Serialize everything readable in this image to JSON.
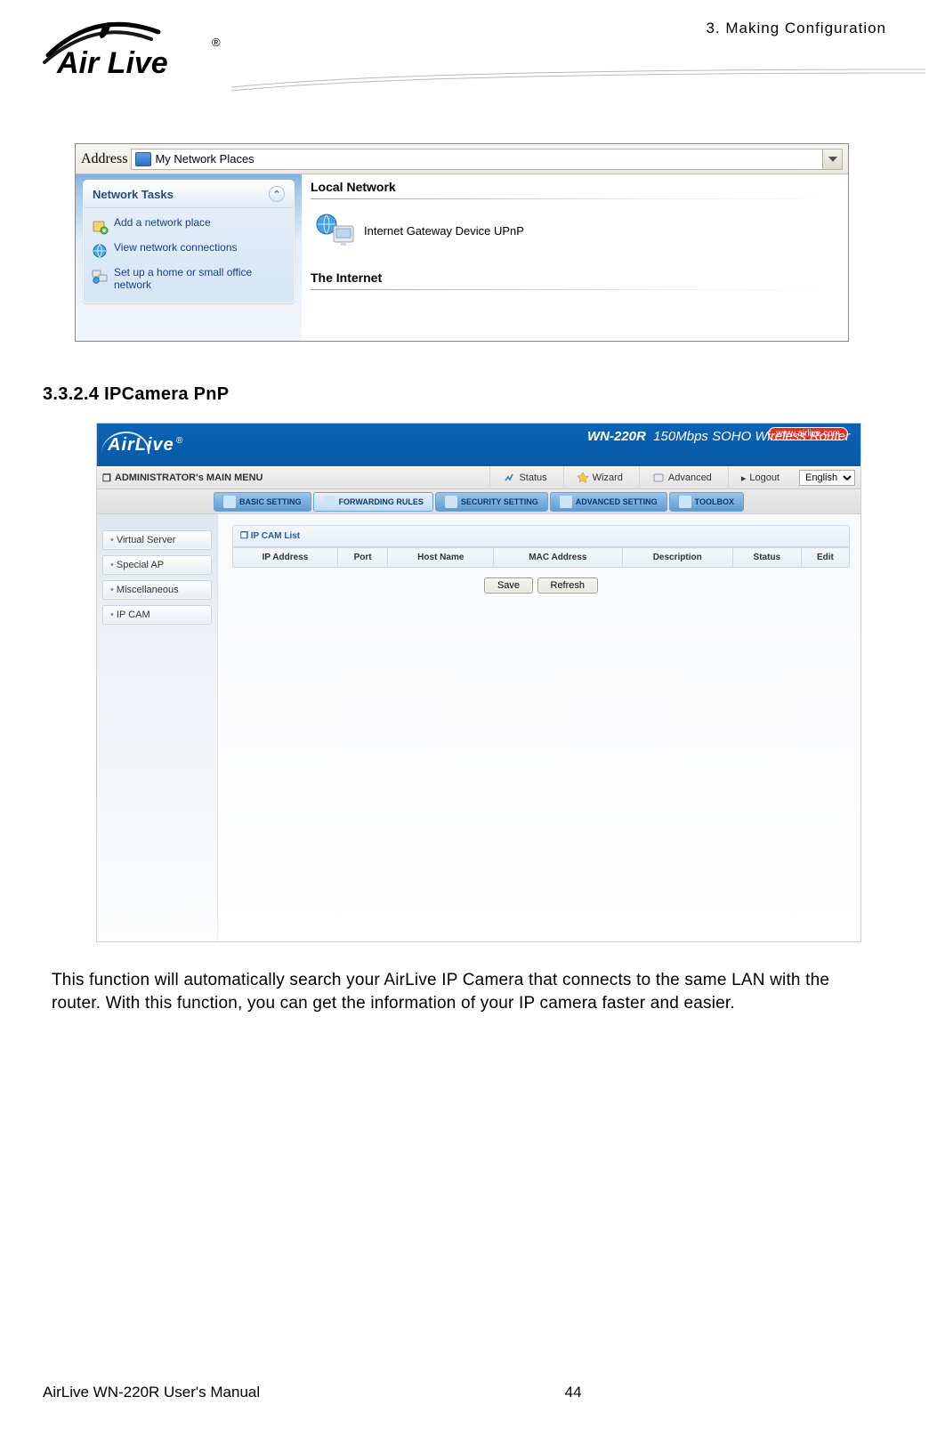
{
  "chapter_header": "3. Making Configuration",
  "logo_text": "Air Live",
  "logo_reg": "®",
  "screenshot1": {
    "address_label": "Address",
    "address_value": "My Network Places",
    "panel_title": "Network Tasks",
    "tasks": {
      "add": "Add a network place",
      "view": "View network connections",
      "setup": "Set up a home or small office network"
    },
    "section_local": "Local Network",
    "igd_label": "Internet Gateway Device UPnP",
    "section_internet": "The Internet"
  },
  "section_heading": "3.3.2.4  IPCamera PnP",
  "router": {
    "brand": "AirLive",
    "reg": "®",
    "model": "WN-220R",
    "tagline": "150Mbps SOHO Wireless Router",
    "url": "www.airlive.com",
    "main_menu_label": "ADMINISTRATOR's MAIN MENU",
    "menu_status": "Status",
    "menu_wizard": "Wizard",
    "menu_advanced": "Advanced",
    "menu_logout": "Logout",
    "lang": "English",
    "tabs": {
      "basic": "BASIC SETTING",
      "forwarding": "FORWARDING RULES",
      "security": "SECURITY SETTING",
      "advanced": "ADVANCED SETTING",
      "toolbox": "TOOLBOX"
    },
    "side": {
      "virtual": "Virtual Server",
      "special": "Special AP",
      "misc": "Miscellaneous",
      "ipcam": "IP CAM"
    },
    "ipcam_list_title": "IP CAM List",
    "cols": {
      "ip": "IP Address",
      "port": "Port",
      "host": "Host Name",
      "mac": "MAC Address",
      "desc": "Description",
      "status": "Status",
      "edit": "Edit"
    },
    "btn_save": "Save",
    "btn_refresh": "Refresh"
  },
  "body_paragraph": "This function will automatically search your AirLive IP Camera that connects to the same LAN with the router. With this function, you can get the information of your IP camera faster and easier.",
  "footer_manual": "AirLive WN-220R User's Manual",
  "footer_page": "44"
}
